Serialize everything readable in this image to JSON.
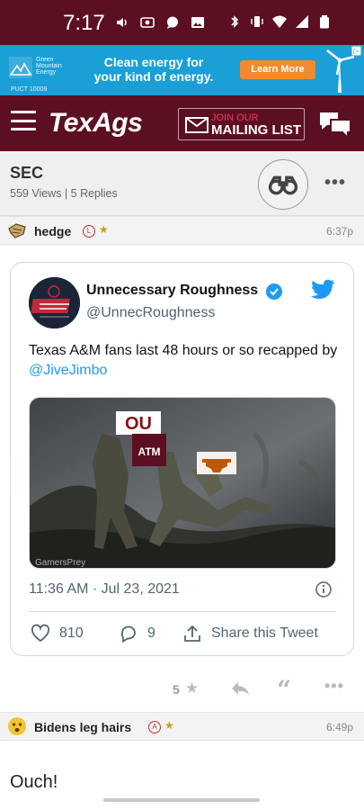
{
  "status_bar": {
    "time": "7:17"
  },
  "ad": {
    "brand_line1": "Green",
    "brand_line2": "Mountain",
    "brand_line3": "Energy",
    "puct": "PUCT 10009",
    "headline_line1": "Clean energy for",
    "headline_line2": "your kind of energy.",
    "cta": "Learn More",
    "colors": {
      "background": "#1a9fd7",
      "cta": "#f28a2e"
    }
  },
  "header": {
    "logo": "TexAgs",
    "mailing_join": "JOIN OUR",
    "mailing_list": "MAILING LIST",
    "colors": {
      "maroon": "#5d0f22"
    }
  },
  "thread": {
    "title": "SEC",
    "meta": "559 Views | 5 Replies",
    "more": "•••"
  },
  "posts": [
    {
      "user": "hedge",
      "rank": "L",
      "time": "6:37p"
    },
    {
      "user": "Bidens leg hairs",
      "rank": "A",
      "time": "6:49p",
      "text": "Ouch!"
    }
  ],
  "tweet": {
    "name": "Unnecessary Roughness",
    "handle": "@UnnecRoughness",
    "text_before": "Texas A&M fans last 48 hours or so recapped by ",
    "mention": "@JiveJimbo",
    "media_watermark": "GamersPrey",
    "media_labels": {
      "oklahoma": "OU",
      "texas_am": "ATM"
    },
    "date": "11:36 AM · Jul 23, 2021",
    "likes": "810",
    "replies": "9",
    "share": "Share this Tweet",
    "colors": {
      "blue": "#1d9bf0"
    }
  },
  "post_actions": {
    "star_count": "5",
    "more": "•••"
  }
}
